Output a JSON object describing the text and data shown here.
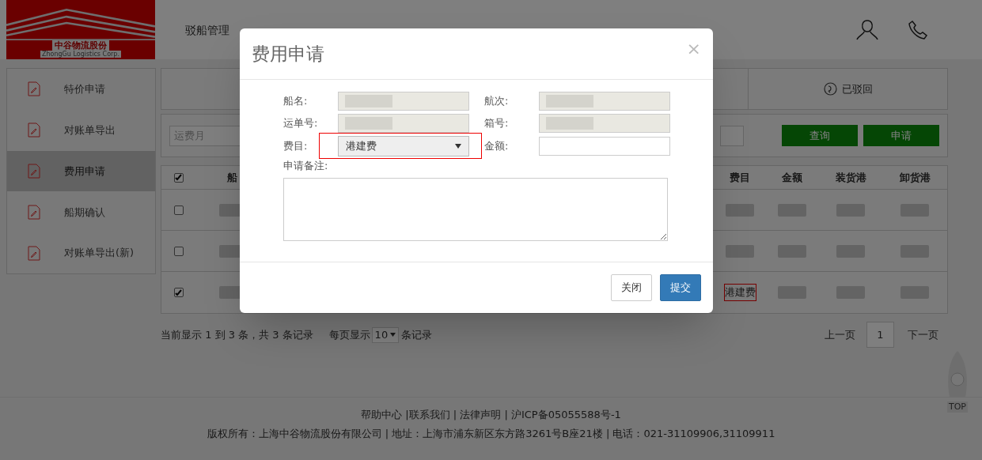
{
  "logo": {
    "name": "中谷物流股份",
    "subtitle": "ZhongGu Logistics Corp."
  },
  "nav": [
    {
      "label": "驳船管理",
      "selected": false
    }
  ],
  "sidebar": {
    "items": [
      {
        "label": "特价申请",
        "selected": false
      },
      {
        "label": "对账单导出",
        "selected": false
      },
      {
        "label": "费用申请",
        "selected": true
      },
      {
        "label": "船期确认",
        "selected": false
      },
      {
        "label": "对账单导出(新)",
        "selected": false
      }
    ]
  },
  "status_tabs": [
    {
      "label": "已驳回"
    }
  ],
  "search": {
    "placeholder": "运费月",
    "buttons": [
      "查询",
      "申请"
    ]
  },
  "table": {
    "all_checked": true,
    "columns": [
      "船",
      "费目",
      "金额",
      "装货港",
      "卸货港"
    ],
    "rows": [
      {
        "checked": false,
        "fee_item": null
      },
      {
        "checked": false,
        "fee_item": null
      },
      {
        "checked": true,
        "fee_item": "港建费",
        "annotated": true
      }
    ]
  },
  "pagination": {
    "summary": "当前显示 1 到 3 条，共 3 条记录",
    "per_page_label": "每页显示",
    "per_page": "10",
    "per_page_suffix": "条记录",
    "prev": "上一页",
    "page": "1",
    "next": "下一页"
  },
  "footer": {
    "links": "帮助中心 |联系我们 | 法律声明 | 沪ICP备05055588号-1",
    "copyright": "版权所有：上海中谷物流股份有限公司 | 地址：上海市浦东新区东方路3261号B座21楼 | 电话：021-31109906,31109911"
  },
  "back_to_top": {
    "label": "TOP"
  },
  "modal": {
    "title": "费用申请",
    "close": "×",
    "fields": [
      {
        "label": "船名:",
        "kind": "readonly"
      },
      {
        "label": "航次:",
        "kind": "readonly"
      },
      {
        "label": "运单号:",
        "kind": "readonly"
      },
      {
        "label": "箱号:",
        "kind": "readonly"
      },
      {
        "label": "费目:",
        "kind": "select",
        "value": "港建费",
        "annotated": true
      },
      {
        "label": "金额:",
        "kind": "input"
      }
    ],
    "remark_label": "申请备注:",
    "buttons": [
      {
        "label": "关闭",
        "primary": false
      },
      {
        "label": "提交",
        "primary": true
      }
    ]
  }
}
